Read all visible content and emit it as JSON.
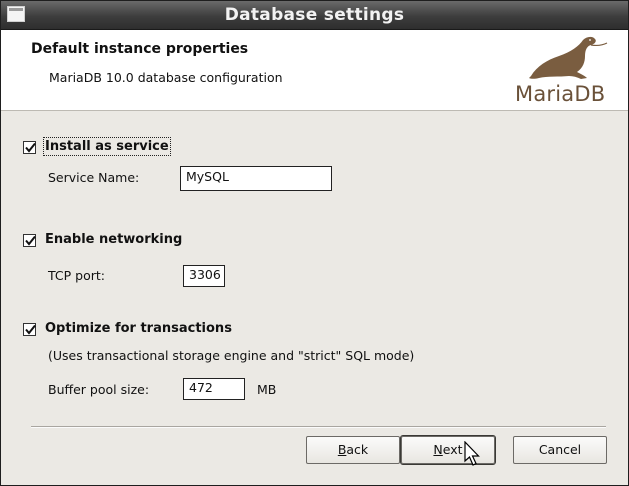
{
  "window": {
    "title": "Database settings"
  },
  "header": {
    "title": "Default instance properties",
    "subtitle": "MariaDB 10.0 database configuration",
    "logo_text": "MariaDB"
  },
  "service": {
    "checkbox_label": "Install as service",
    "checked": true,
    "name_label": "Service Name:",
    "name_value": "MySQL"
  },
  "networking": {
    "checkbox_label": "Enable networking",
    "checked": true,
    "port_label": "TCP port:",
    "port_value": "3306"
  },
  "transactions": {
    "checkbox_label": "Optimize for transactions",
    "checked": true,
    "description": "(Uses transactional storage engine and \"strict\" SQL mode)",
    "buffer_label": "Buffer pool size:",
    "buffer_value": "472",
    "buffer_unit": "MB"
  },
  "buttons": {
    "back": {
      "label": "Back",
      "mnemonic": "B",
      "rest": "ack"
    },
    "next": {
      "label": "Next",
      "mnemonic": "N",
      "rest": "ext"
    },
    "cancel": {
      "label": "Cancel"
    }
  },
  "colors": {
    "titlebar": "#3d3d3d",
    "dialog_bg": "#ebe9e4",
    "logo_brown": "#6a5139"
  }
}
